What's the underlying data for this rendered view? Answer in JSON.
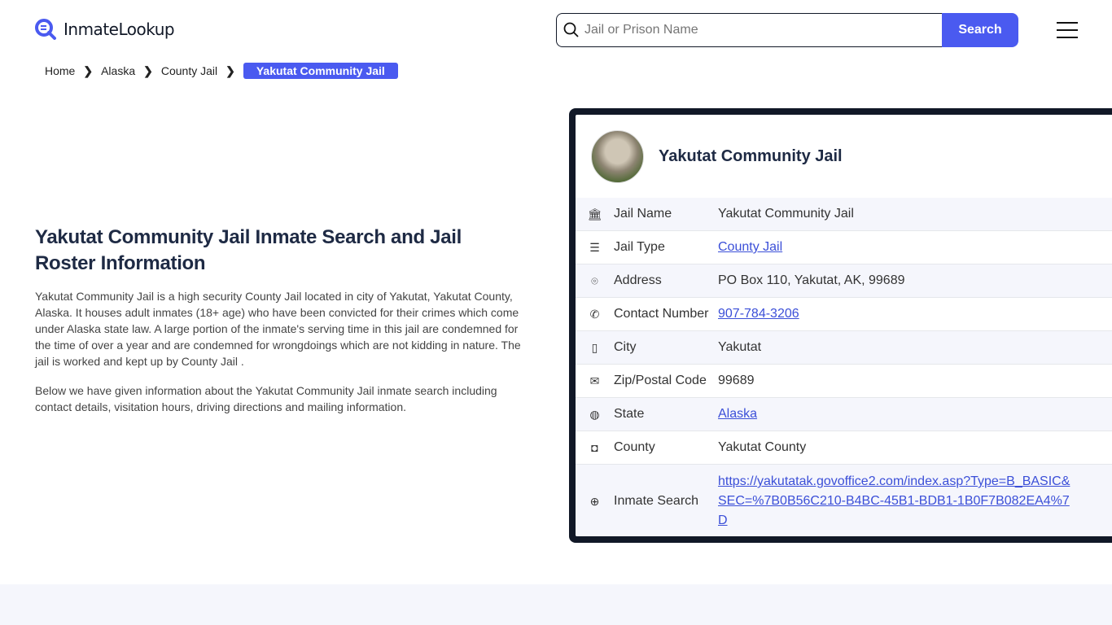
{
  "header": {
    "logo": "InmateLookup",
    "search_placeholder": "Jail or Prison Name",
    "search_button": "Search"
  },
  "breadcrumb": [
    "Home",
    "Alaska",
    "County Jail",
    "Yakutat Community Jail"
  ],
  "main": {
    "title": "Yakutat Community Jail Inmate Search and Jail Roster Information",
    "para1": "Yakutat Community Jail is a high security County Jail located in city of Yakutat, Yakutat County, Alaska. It houses adult inmates (18+ age) who have been convicted for their crimes which come under Alaska state law. A large portion of the inmate's serving time in this jail are condemned for the time of over a year and are condemned for wrongdoings which are not kidding in nature. The jail is worked and kept up by County Jail .",
    "para2": "Below we have given information about the Yakutat Community Jail inmate search including contact details, visitation hours, driving directions and mailing information."
  },
  "card": {
    "title": "Yakutat Community Jail",
    "rows": [
      {
        "icon": "building-icon",
        "label": "Jail Name",
        "value": "Yakutat Community Jail",
        "link": false
      },
      {
        "icon": "list-icon",
        "label": "Jail Type",
        "value": "County Jail",
        "link": true
      },
      {
        "icon": "location-pin-icon",
        "label": "Address",
        "value": "PO Box 110, Yakutat, AK, 99689",
        "link": false
      },
      {
        "icon": "phone-icon",
        "label": "Contact Number",
        "value": "907-784-3206",
        "link": true
      },
      {
        "icon": "map-icon",
        "label": "City",
        "value": "Yakutat",
        "link": false
      },
      {
        "icon": "mail-icon",
        "label": "Zip/Postal Code",
        "value": "99689",
        "link": false
      },
      {
        "icon": "globe-icon",
        "label": "State",
        "value": "Alaska",
        "link": true
      },
      {
        "icon": "county-icon",
        "label": "County",
        "value": "Yakutat County",
        "link": false
      },
      {
        "icon": "web-icon",
        "label": "Inmate Search",
        "value": "https://yakutatak.govoffice2.com/index.asp?Type=B_BASIC&SEC=%7B0B56C210-B4BC-45B1-BDB1-1B0F7B082EA4%7D",
        "link": true
      }
    ]
  },
  "colors": {
    "accent": "#4a5af0",
    "card_border": "#111827",
    "link": "#3b4fd8"
  }
}
